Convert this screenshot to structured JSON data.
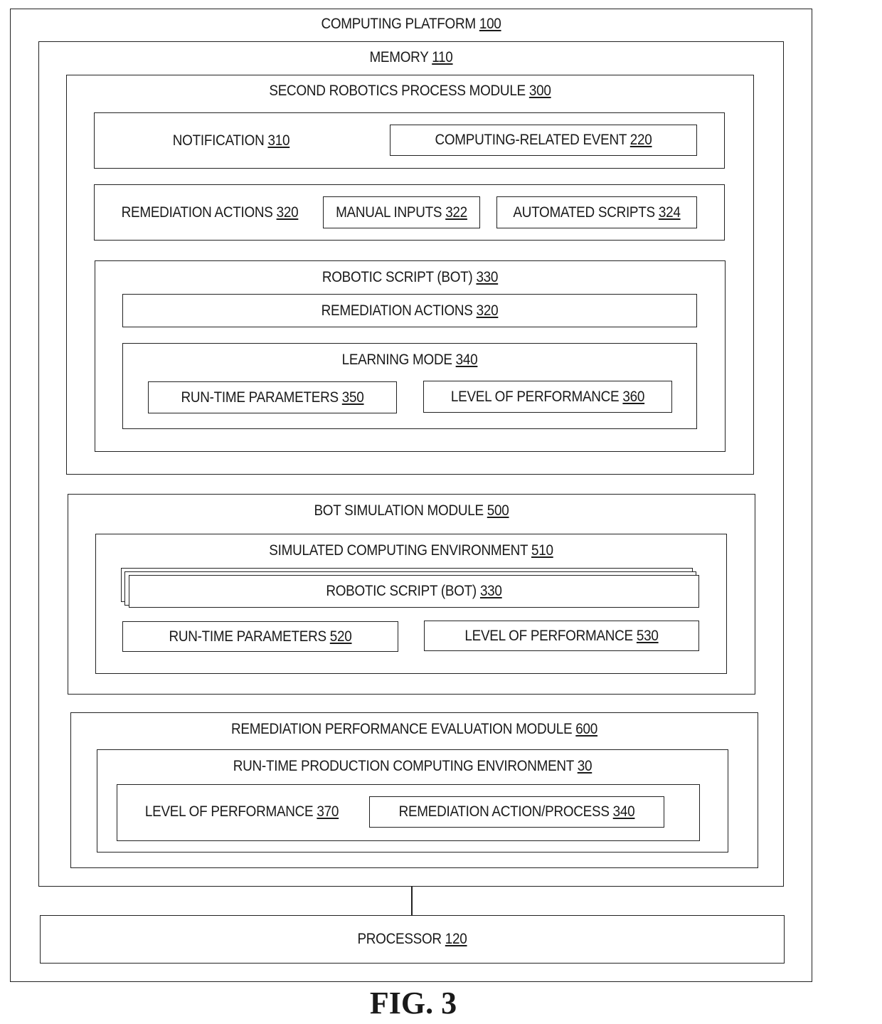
{
  "figure_label": "FIG. 3",
  "computing_platform": {
    "name": "COMPUTING PLATFORM",
    "ref": "100"
  },
  "memory": {
    "name": "MEMORY",
    "ref": "110"
  },
  "second_robotics_module": {
    "name": "SECOND ROBOTICS PROCESS MODULE",
    "ref": "300",
    "notification": {
      "name": "NOTIFICATION",
      "ref": "310"
    },
    "computing_event": {
      "name": "COMPUTING-RELATED EVENT",
      "ref": "220"
    },
    "remediation_actions": {
      "name": "REMEDIATION ACTIONS",
      "ref": "320"
    },
    "manual_inputs": {
      "name": "MANUAL INPUTS",
      "ref": "322"
    },
    "automated_scripts": {
      "name": "AUTOMATED SCRIPTS ",
      "ref": "324"
    },
    "robotic_script": {
      "name": "ROBOTIC SCRIPT (BOT)",
      "ref": "330",
      "remediation_actions": {
        "name": "REMEDIATION ACTIONS",
        "ref": "320"
      },
      "learning_mode": {
        "name": "LEARNING MODE",
        "ref": "340",
        "runtime_parameters": {
          "name": "RUN-TIME PARAMETERS",
          "ref": "350"
        },
        "level_of_performance": {
          "name": "LEVEL OF PERFORMANCE",
          "ref": "360"
        }
      }
    }
  },
  "bot_simulation_module": {
    "name": "BOT SIMULATION MODULE",
    "ref": "500",
    "simulated_env": {
      "name": "SIMULATED COMPUTING ENVIRONMENT",
      "ref": "510"
    },
    "robotic_script": {
      "name": "ROBOTIC SCRIPT (BOT)",
      "ref": "330"
    },
    "runtime_parameters": {
      "name": "RUN-TIME PARAMETERS",
      "ref": "520"
    },
    "level_of_performance": {
      "name": "LEVEL OF PERFORMANCE",
      "ref": "530"
    }
  },
  "remediation_eval_module": {
    "name": "REMEDIATION PERFORMANCE EVALUATION MODULE",
    "ref": "600",
    "production_env": {
      "name": "RUN-TIME PRODUCTION COMPUTING ENVIRONMENT",
      "ref": "30"
    },
    "level_of_performance": {
      "name": "LEVEL OF PERFORMANCE",
      "ref": "370"
    },
    "remediation_process": {
      "name": "REMEDIATION ACTION/PROCESS ",
      "ref": "340"
    }
  },
  "processor": {
    "name": "PROCESSOR",
    "ref": "120"
  }
}
